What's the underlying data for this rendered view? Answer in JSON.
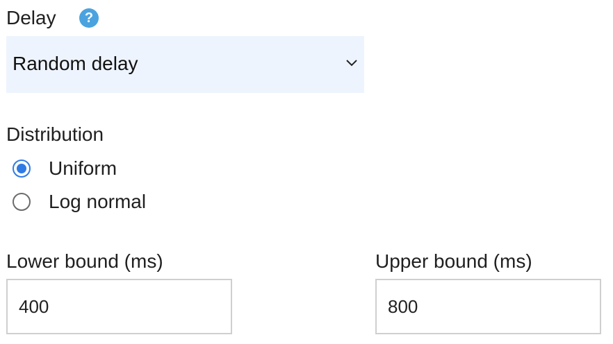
{
  "delay": {
    "label": "Delay",
    "help_icon": "?",
    "select_value": "Random delay"
  },
  "distribution": {
    "label": "Distribution",
    "options": [
      {
        "label": "Uniform",
        "checked": true
      },
      {
        "label": "Log normal",
        "checked": false
      }
    ]
  },
  "lower_bound": {
    "label": "Lower bound (ms)",
    "value": "400"
  },
  "upper_bound": {
    "label": "Upper bound (ms)",
    "value": "800"
  },
  "colors": {
    "accent": "#2f7be5",
    "help_icon": "#4aa3df",
    "select_bg": "#eef4fd"
  },
  "icons": {
    "help": "question-circle-icon",
    "dropdown": "chevron-down-icon"
  }
}
